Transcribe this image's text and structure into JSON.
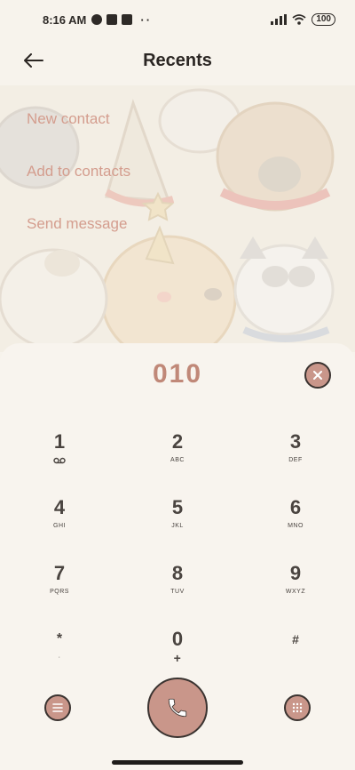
{
  "status_bar": {
    "time": "8:16 AM",
    "more": "··",
    "battery": "100",
    "icons": [
      "app-notification-icon",
      "square-notification-icon",
      "upload-notification-icon",
      "signal-icon",
      "wifi-icon",
      "battery-icon"
    ]
  },
  "header": {
    "title": "Recents",
    "back_icon": "arrow-left-icon"
  },
  "actions": [
    {
      "label": "New contact"
    },
    {
      "label": "Add to contacts"
    },
    {
      "label": "Send message"
    }
  ],
  "dialer": {
    "number": "010",
    "clear_icon": "close-icon"
  },
  "keypad": [
    {
      "digit": "1",
      "sub": "",
      "sub_icon": "voicemail-icon"
    },
    {
      "digit": "2",
      "sub": "ABC"
    },
    {
      "digit": "3",
      "sub": "DEF"
    },
    {
      "digit": "4",
      "sub": "GHI"
    },
    {
      "digit": "5",
      "sub": "JKL"
    },
    {
      "digit": "6",
      "sub": "MNO"
    },
    {
      "digit": "7",
      "sub": "PQRS"
    },
    {
      "digit": "8",
      "sub": "TUV"
    },
    {
      "digit": "9",
      "sub": "WXYZ"
    },
    {
      "digit": "*",
      "sub": "·"
    },
    {
      "digit": "0",
      "sub": "+"
    },
    {
      "digit": "#",
      "sub": ""
    }
  ],
  "bottom": {
    "menu_icon": "menu-icon",
    "call_icon": "phone-icon",
    "dialpad_icon": "dialpad-icon"
  },
  "colors": {
    "background": "#f7f3ec",
    "accent": "#c9968a",
    "action_text": "#d49d8e",
    "number_text": "#c08878"
  }
}
